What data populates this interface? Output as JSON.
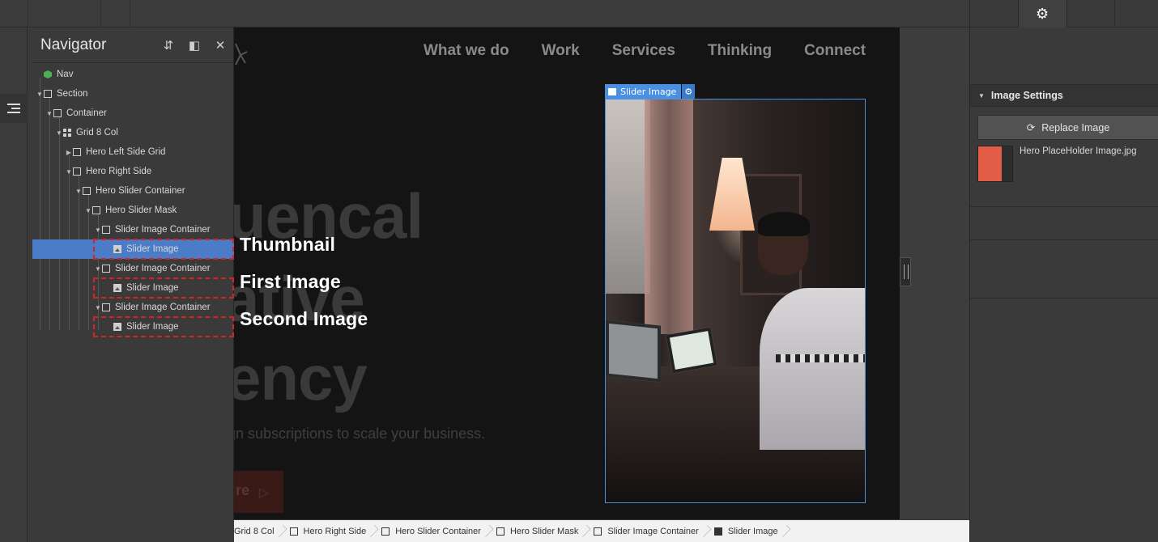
{
  "canvas": {
    "nav_links": [
      "What we do",
      "Work",
      "Services",
      "Thinking",
      "Connect"
    ],
    "hero_lines": [
      "uencal",
      "ative",
      "ency"
    ],
    "hero_subtitle": "gn subscriptions to scale your business.",
    "hero_button_text": "re",
    "selection_tag_label": "Slider Image"
  },
  "navigator": {
    "title": "Navigator",
    "rows": [
      {
        "label": "Nav",
        "icon": "cube-icon"
      },
      {
        "label": "Section",
        "icon": "box-icon"
      },
      {
        "label": "Container",
        "icon": "box-icon"
      },
      {
        "label": "Grid 8 Col",
        "icon": "grid-icon"
      },
      {
        "label": "Hero Left Side Grid",
        "icon": "box-icon"
      },
      {
        "label": "Hero Right Side",
        "icon": "box-icon"
      },
      {
        "label": "Hero Slider Container",
        "icon": "box-icon"
      },
      {
        "label": "Hero Slider Mask",
        "icon": "box-icon"
      },
      {
        "label": "Slider Image Container",
        "icon": "box-icon"
      },
      {
        "label": "Slider Image",
        "icon": "image-icon"
      },
      {
        "label": "Slider Image Container",
        "icon": "box-icon"
      },
      {
        "label": "Slider Image",
        "icon": "image-icon"
      },
      {
        "label": "Slider Image Container",
        "icon": "box-icon"
      },
      {
        "label": "Slider Image",
        "icon": "image-icon"
      }
    ]
  },
  "annotations": {
    "thumbnail": "Thumbnail",
    "first": "First Image",
    "second": "Second Image"
  },
  "settings": {
    "section_title": "Image Settings",
    "replace_label": "Replace Image",
    "filename": "Hero PlaceHolder Image.jpg",
    "thumb_color": "#e35c45"
  },
  "breadcrumb": [
    {
      "label": "Grid 8 Col",
      "icon": "box-icon"
    },
    {
      "label": "Hero Right Side",
      "icon": "box-icon"
    },
    {
      "label": "Hero Slider Container",
      "icon": "box-icon"
    },
    {
      "label": "Hero Slider Mask",
      "icon": "box-icon"
    },
    {
      "label": "Slider Image Container",
      "icon": "box-icon"
    },
    {
      "label": "Slider Image",
      "icon": "image-icon"
    }
  ],
  "colors": {
    "selection_blue": "#4a90e2",
    "annotation_red": "#d42424"
  }
}
